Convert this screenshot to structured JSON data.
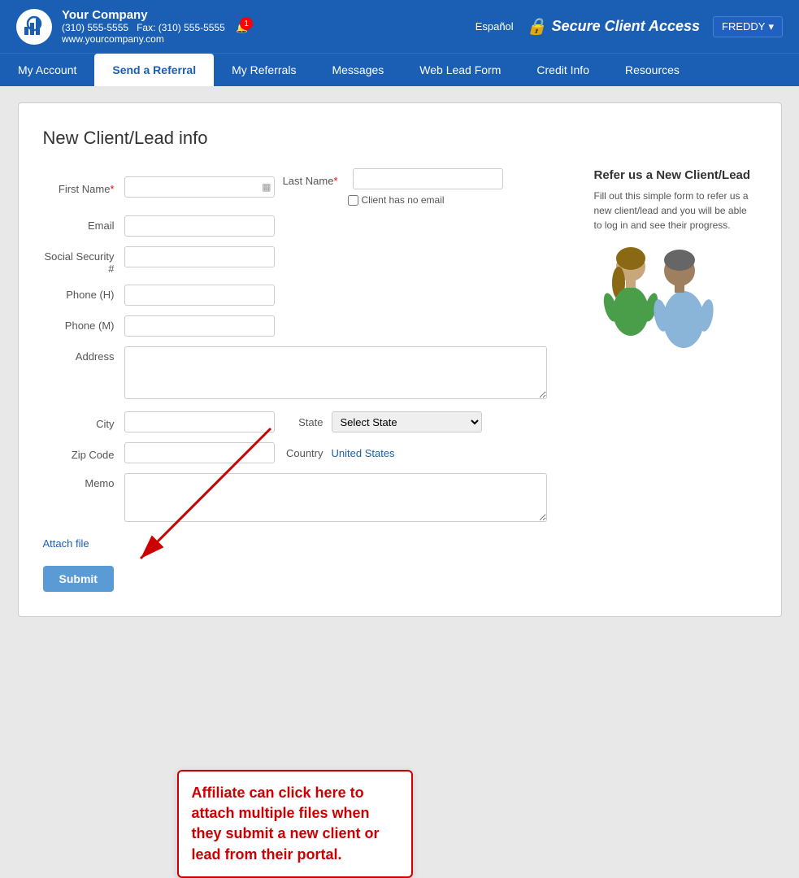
{
  "company": {
    "name": "Your Company",
    "phone": "(310) 555-5555",
    "fax": "Fax: (310) 555-5555",
    "url": "www.yourcompany.com"
  },
  "header": {
    "espanol": "Español",
    "secure_label": "Secure Client Access",
    "user": "FREDDY",
    "notification_count": "1"
  },
  "nav": {
    "items": [
      {
        "label": "My Account",
        "active": false
      },
      {
        "label": "Send a Referral",
        "active": true
      },
      {
        "label": "My Referrals",
        "active": false
      },
      {
        "label": "Messages",
        "active": false
      },
      {
        "label": "Web Lead Form",
        "active": false
      },
      {
        "label": "Credit Info",
        "active": false
      },
      {
        "label": "Resources",
        "active": false
      }
    ]
  },
  "form": {
    "title": "New Client/Lead info",
    "fields": {
      "first_name_label": "First Name",
      "last_name_label": "Last Name",
      "email_label": "Email",
      "social_security_label": "Social Security #",
      "phone_h_label": "Phone (H)",
      "phone_m_label": "Phone (M)",
      "address_label": "Address",
      "city_label": "City",
      "state_label": "State",
      "zip_code_label": "Zip Code",
      "country_label": "Country",
      "memo_label": "Memo",
      "no_email_label": "Client has no email",
      "state_placeholder": "Select State",
      "country_value": "United States"
    },
    "attach_file": "Attach file",
    "submit": "Submit"
  },
  "sidebar": {
    "title": "Refer us a New Client/Lead",
    "description": "Fill out this simple form to refer us a new client/lead and you will be able to log in and see their progress."
  },
  "callout": {
    "text": "Affiliate can click here to attach multiple files when they submit a new client or lead from their portal."
  }
}
